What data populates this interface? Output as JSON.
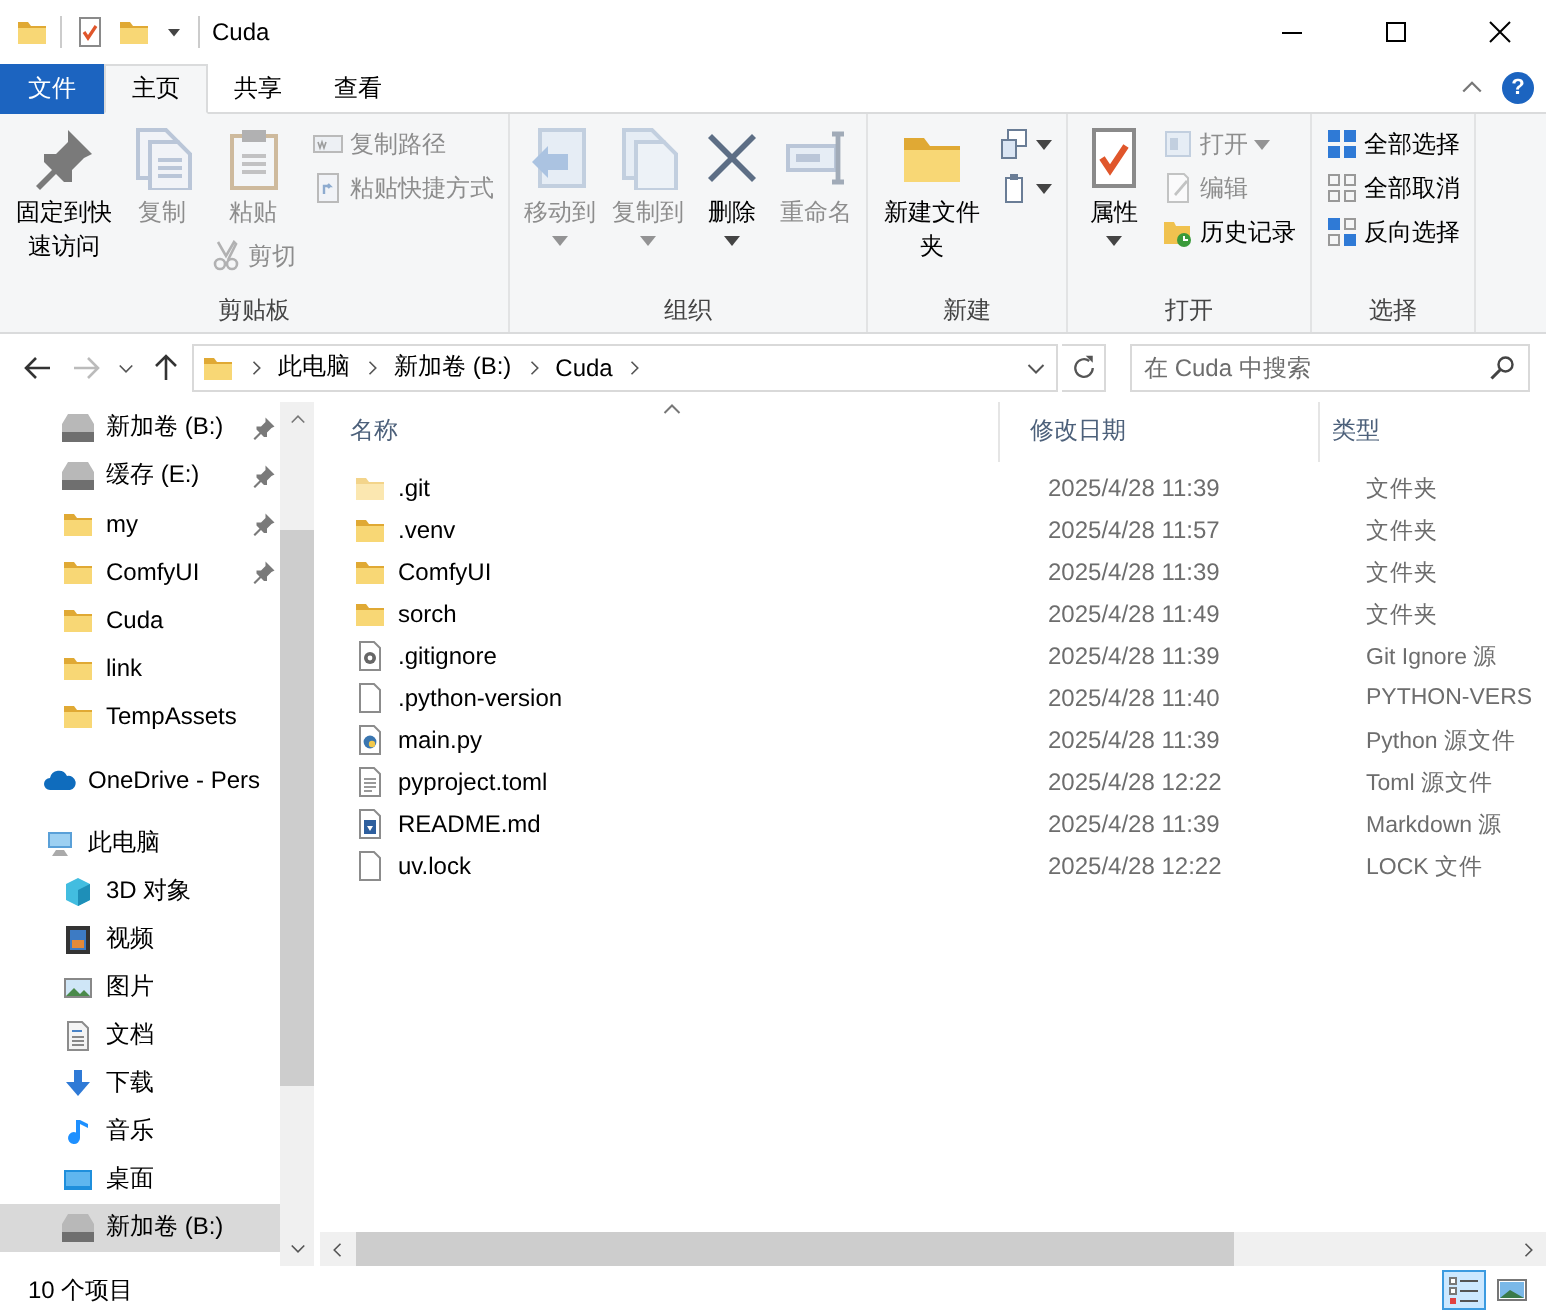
{
  "window": {
    "title": "Cuda",
    "help": "?"
  },
  "tabs": [
    {
      "label": "文件",
      "kind": "file",
      "selected": false
    },
    {
      "label": "主页",
      "kind": "tab",
      "selected": true
    },
    {
      "label": "共享",
      "kind": "tab",
      "selected": false
    },
    {
      "label": "查看",
      "kind": "tab",
      "selected": false
    }
  ],
  "ribbon": {
    "groups": [
      {
        "label": "剪贴板",
        "columns": [
          [
            {
              "label": "固定到快速访问",
              "kind": "large",
              "disabled": false,
              "menu": false
            }
          ],
          [
            {
              "label": "复制",
              "kind": "large",
              "disabled": true,
              "menu": false
            }
          ],
          [
            {
              "label": "粘贴",
              "kind": "large",
              "disabled": true,
              "menu": false
            },
            {
              "label": "剪切",
              "kind": "small",
              "disabled": true,
              "menu": false
            }
          ],
          [
            {
              "label": "复制路径",
              "kind": "small",
              "disabled": true,
              "menu": false
            },
            {
              "label": "粘贴快捷方式",
              "kind": "small",
              "disabled": true,
              "menu": false
            }
          ]
        ]
      },
      {
        "label": "组织",
        "columns": [
          [
            {
              "label": "移动到",
              "kind": "large",
              "disabled": true,
              "menu": true
            }
          ],
          [
            {
              "label": "复制到",
              "kind": "large",
              "disabled": true,
              "menu": true
            }
          ],
          [
            {
              "label": "删除",
              "kind": "large",
              "disabled": false,
              "menu": true
            }
          ],
          [
            {
              "label": "重命名",
              "kind": "large",
              "disabled": true,
              "menu": false
            }
          ]
        ]
      },
      {
        "label": "新建",
        "columns": [
          [
            {
              "label": "新建文件夹",
              "kind": "large",
              "disabled": false,
              "menu": false
            }
          ],
          [
            {
              "kind": "small",
              "disabled": false,
              "menu": true
            },
            {
              "kind": "small",
              "disabled": false,
              "menu": true
            }
          ]
        ]
      },
      {
        "label": "打开",
        "columns": [
          [
            {
              "label": "属性",
              "kind": "large",
              "disabled": false,
              "menu": true
            }
          ],
          [
            {
              "label": "打开",
              "kind": "small",
              "disabled": true,
              "menu": true
            },
            {
              "label": "编辑",
              "kind": "small",
              "disabled": true,
              "menu": false
            },
            {
              "label": "历史记录",
              "kind": "small",
              "disabled": false,
              "menu": false
            }
          ]
        ]
      },
      {
        "label": "选择",
        "columns": [
          [
            {
              "label": "全部选择",
              "kind": "small",
              "disabled": false,
              "menu": false
            },
            {
              "label": "全部取消",
              "kind": "small",
              "disabled": false,
              "menu": false
            },
            {
              "label": "反向选择",
              "kind": "small",
              "disabled": false,
              "menu": false
            }
          ]
        ]
      }
    ]
  },
  "address": {
    "breadcrumbs": [
      "此电脑",
      "新加卷 (B:)",
      "Cuda"
    ],
    "search_placeholder": "在 Cuda 中搜索"
  },
  "sidebar": {
    "quick_access": [
      {
        "label": "新加卷 (B:)",
        "kind": "drive",
        "pinned": true,
        "selected": false
      },
      {
        "label": "缓存 (E:)",
        "kind": "drive",
        "pinned": true,
        "selected": false
      },
      {
        "label": "my",
        "kind": "folder",
        "pinned": true,
        "selected": false
      },
      {
        "label": "ComfyUI",
        "kind": "folder",
        "pinned": true,
        "selected": false
      },
      {
        "label": "Cuda",
        "kind": "folder",
        "pinned": false,
        "selected": false
      },
      {
        "label": "link",
        "kind": "folder",
        "pinned": false,
        "selected": false
      },
      {
        "label": "TempAssets",
        "kind": "folder",
        "pinned": false,
        "selected": false
      }
    ],
    "onedrive": {
      "label": "OneDrive - Pers",
      "selected": false
    },
    "this_pc": {
      "label": "此电脑",
      "selected": false,
      "children": [
        {
          "label": "3D 对象",
          "kind": "cube",
          "selected": false
        },
        {
          "label": "视频",
          "kind": "film",
          "selected": false
        },
        {
          "label": "图片",
          "kind": "image",
          "selected": false
        },
        {
          "label": "文档",
          "kind": "doc",
          "selected": false
        },
        {
          "label": "下载",
          "kind": "download",
          "selected": false
        },
        {
          "label": "音乐",
          "kind": "music",
          "selected": false
        },
        {
          "label": "桌面",
          "kind": "desktop",
          "selected": false
        },
        {
          "label": "新加卷 (B:)",
          "kind": "drive",
          "selected": true
        }
      ]
    }
  },
  "file_list": {
    "columns": [
      "名称",
      "修改日期",
      "类型"
    ],
    "rows": [
      {
        "name": ".git",
        "modified": "2025/4/28 11:39",
        "type": "文件夹",
        "kind": "folder-light"
      },
      {
        "name": ".venv",
        "modified": "2025/4/28 11:57",
        "type": "文件夹",
        "kind": "folder"
      },
      {
        "name": "ComfyUI",
        "modified": "2025/4/28 11:39",
        "type": "文件夹",
        "kind": "folder"
      },
      {
        "name": "sorch",
        "modified": "2025/4/28 11:49",
        "type": "文件夹",
        "kind": "folder"
      },
      {
        "name": ".gitignore",
        "modified": "2025/4/28 11:39",
        "type": "Git Ignore 源",
        "kind": "settings"
      },
      {
        "name": ".python-version",
        "modified": "2025/4/28 11:40",
        "type": "PYTHON-VERS",
        "kind": "blank"
      },
      {
        "name": "main.py",
        "modified": "2025/4/28 11:39",
        "type": "Python 源文件",
        "kind": "python"
      },
      {
        "name": "pyproject.toml",
        "modified": "2025/4/28 12:22",
        "type": "Toml 源文件",
        "kind": "text"
      },
      {
        "name": "README.md",
        "modified": "2025/4/28 11:39",
        "type": "Markdown 源",
        "kind": "markdown"
      },
      {
        "name": "uv.lock",
        "modified": "2025/4/28 12:22",
        "type": "LOCK 文件",
        "kind": "blank"
      }
    ]
  },
  "status_bar": {
    "count": "10 个项目",
    "views": [
      {
        "kind": "details",
        "selected": true
      },
      {
        "kind": "large-icons",
        "selected": false
      }
    ]
  }
}
